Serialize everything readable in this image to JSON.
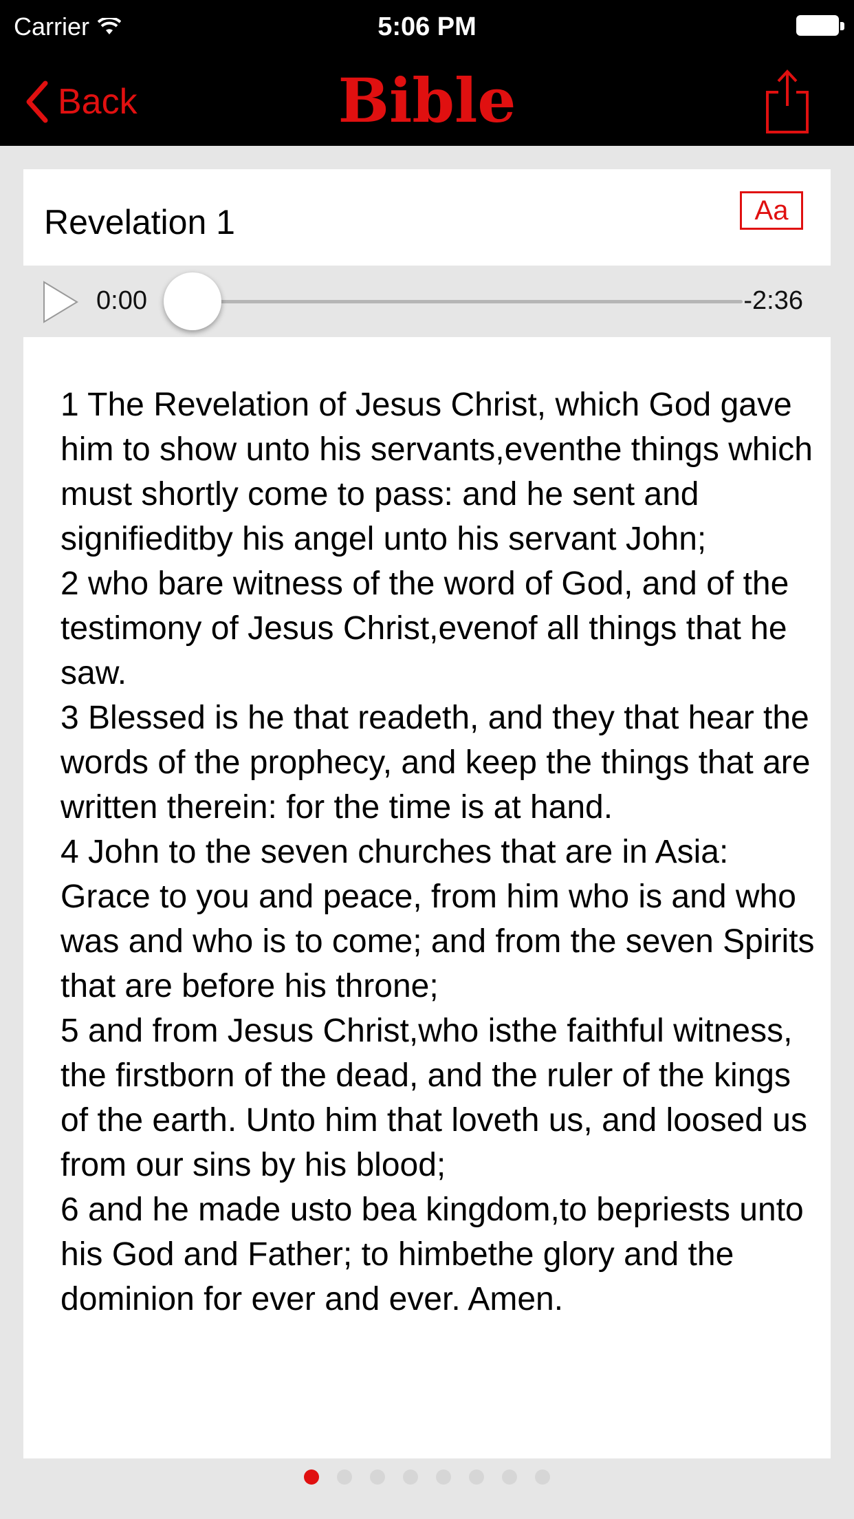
{
  "status_bar": {
    "carrier": "Carrier",
    "time": "5:06 PM",
    "wifi_icon": "wifi-icon",
    "battery_icon": "battery-icon"
  },
  "nav": {
    "back_label": "Back",
    "title": "Bible",
    "share_icon": "share-icon",
    "accent_color": "#e01010"
  },
  "chapter": {
    "title": "Revelation 1",
    "font_button_label": "Aa"
  },
  "player": {
    "current_time": "0:00",
    "remaining_time": "-2:36",
    "progress": 0
  },
  "verses": [
    "1 The Revelation of Jesus Christ, which God gave him to show unto his servants,eventhe things which must shortly come to pass: and he sent and signifieditby his angel unto his servant John;",
    "2 who bare witness of the word of God, and of the testimony of Jesus Christ,evenof all things that he saw.",
    "3 Blessed is he that readeth, and they that hear the words of the prophecy, and keep the things that are written therein: for the time is at hand.",
    "4 John to the seven churches that are in Asia: Grace to you and peace, from him who is and who was and who is to come; and from the seven Spirits that are before his throne;",
    "5 and from Jesus Christ,who isthe faithful witness, the firstborn of the dead, and the ruler of the kings of the earth. Unto him that loveth us, and loosed us from our sins by his blood;",
    "6 and he made usto bea kingdom,to bepriests unto his God and Father; to himbethe glory and the dominion for ever and ever. Amen."
  ],
  "pager": {
    "page_count": 8,
    "current_page": 1
  }
}
